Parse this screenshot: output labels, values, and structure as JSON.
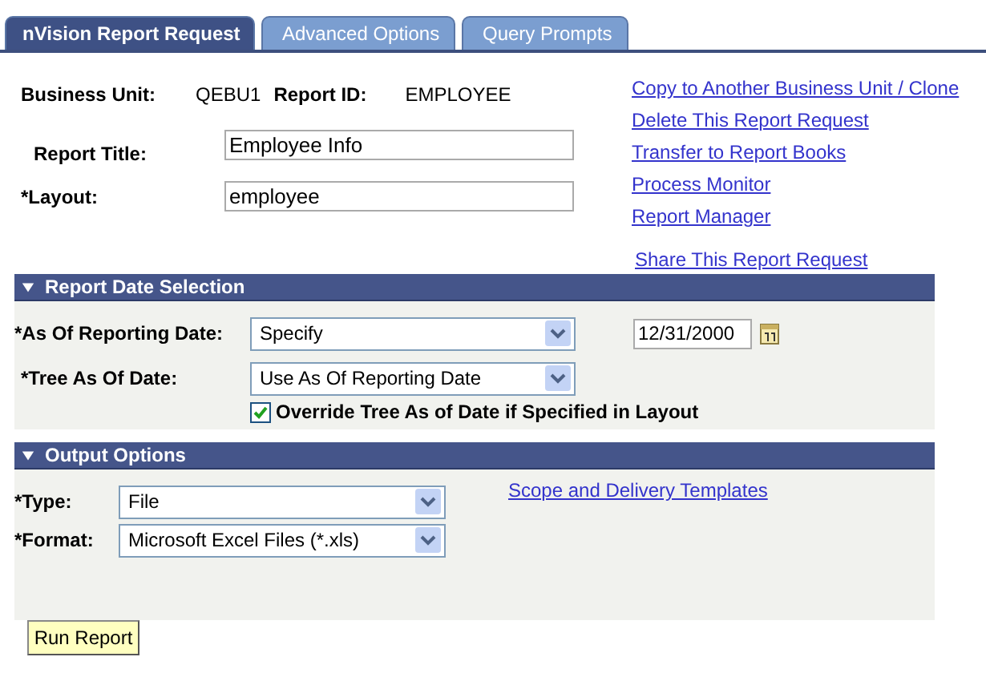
{
  "tabs": [
    {
      "label": "nVision Report Request",
      "selected": true
    },
    {
      "label": "Advanced Options",
      "selected": false
    },
    {
      "label": "Query Prompts",
      "selected": false
    }
  ],
  "header": {
    "business_unit_label": "Business Unit:",
    "business_unit": "QEBU1",
    "report_id_label": "Report ID:",
    "report_id": "EMPLOYEE"
  },
  "fields": [
    {
      "label": "Report Title:",
      "value": "Employee Info"
    },
    {
      "label": "*Layout:",
      "value": "employee"
    }
  ],
  "links": [
    "Copy to Another Business Unit / Clone",
    "Delete This Report Request",
    "Transfer to Report Books",
    "Process Monitor",
    "Report Manager"
  ],
  "share_link": "Share This Report Request",
  "date_section": {
    "title": "Report Date Selection",
    "expanded": true,
    "as_of": {
      "label": "*As Of Reporting Date:",
      "value": "Specify"
    },
    "date": "12/31/2000",
    "tree": {
      "label": "*Tree As Of Date:",
      "value": "Use As Of Reporting Date"
    },
    "override": {
      "label": "Override Tree As of Date if Specified in Layout",
      "checked": true
    }
  },
  "output_section": {
    "title": "Output Options",
    "expanded": true,
    "selects": [
      {
        "label": "*Type:",
        "value": "File"
      },
      {
        "label": "*Format:",
        "value": "Microsoft Excel Files (*.xls)"
      }
    ],
    "link": "Scope and Delivery Templates"
  },
  "run_button": "Run Report"
}
